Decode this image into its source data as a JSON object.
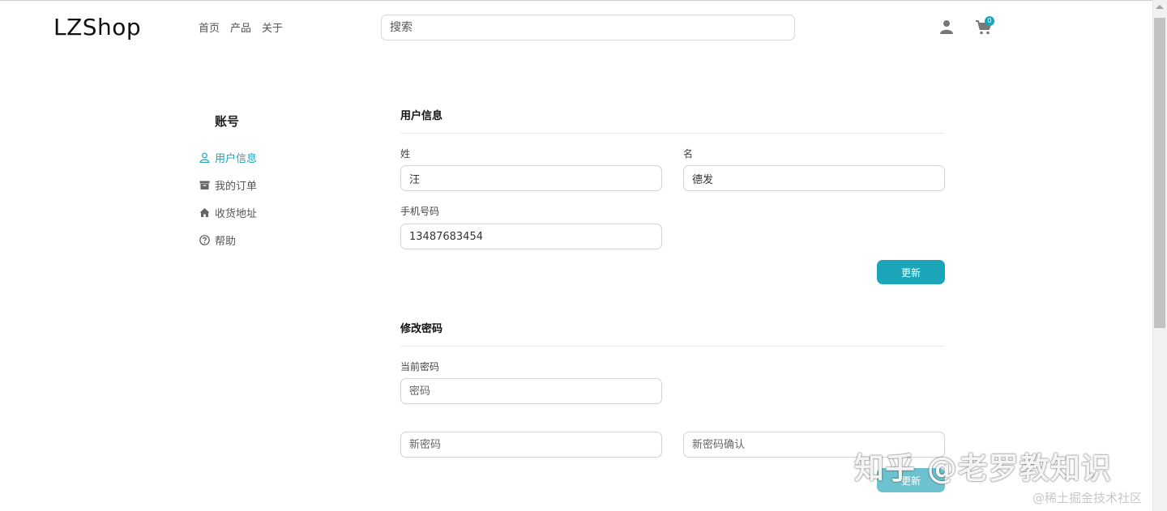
{
  "header": {
    "logo": "LZShop",
    "nav": [
      "首页",
      "产品",
      "关于"
    ],
    "search_placeholder": "搜索",
    "cart_count": "0"
  },
  "sidebar": {
    "title": "账号",
    "items": [
      {
        "label": "用户信息",
        "icon": "user-outline-icon",
        "active": true
      },
      {
        "label": "我的订单",
        "icon": "archive-box-icon",
        "active": false
      },
      {
        "label": "收货地址",
        "icon": "home-icon",
        "active": false
      },
      {
        "label": "帮助",
        "icon": "help-circle-icon",
        "active": false
      }
    ]
  },
  "user_info": {
    "title": "用户信息",
    "last_name_label": "姓",
    "last_name_value": "汪",
    "first_name_label": "名",
    "first_name_value": "德发",
    "phone_label": "手机号码",
    "phone_value": "13487683454",
    "update_label": "更新"
  },
  "password": {
    "title": "修改密码",
    "current_label": "当前密码",
    "current_placeholder": "密码",
    "new_placeholder": "新密码",
    "confirm_placeholder": "新密码确认",
    "update_label": "更新"
  },
  "watermark": {
    "main": "知乎 @老罗教知识",
    "sub": "@稀土掘金技术社区"
  },
  "colors": {
    "accent": "#1ba5b8"
  }
}
